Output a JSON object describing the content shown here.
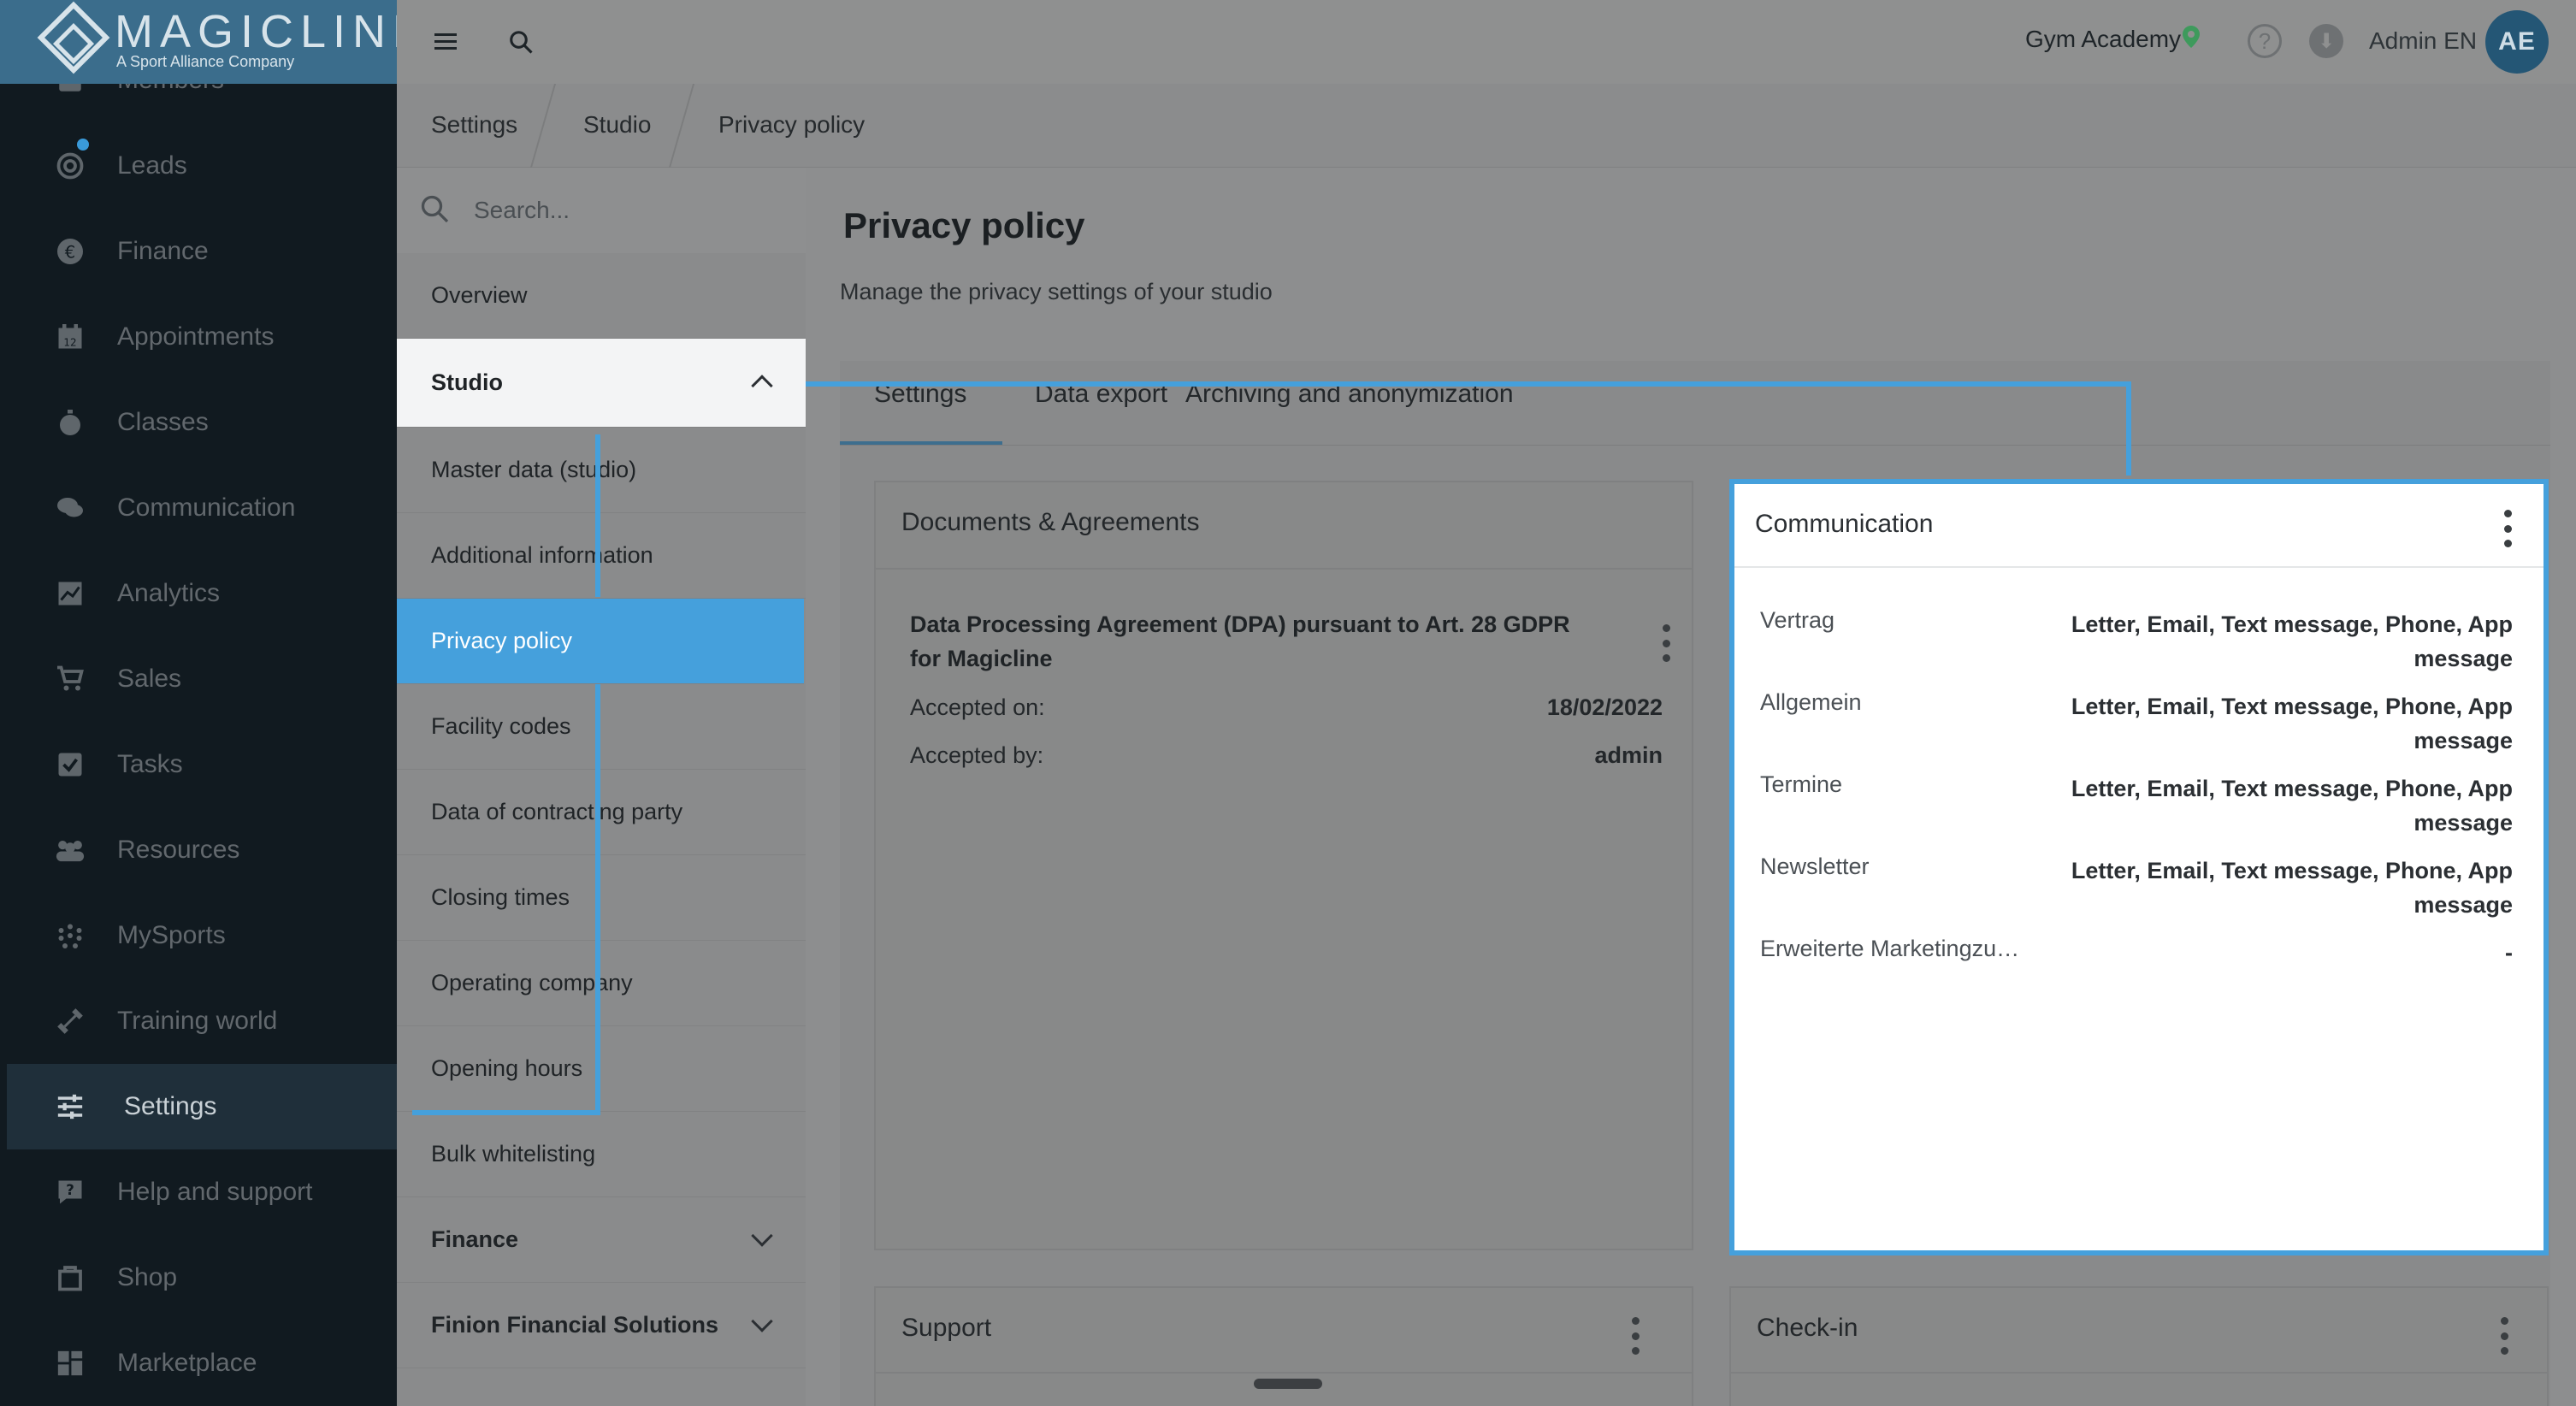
{
  "brand": {
    "name": "MAGICLINE",
    "tagline": "A Sport Alliance Company"
  },
  "nav": {
    "items": [
      {
        "label": "Members",
        "icon": "members-icon"
      },
      {
        "label": "Leads",
        "icon": "leads-icon"
      },
      {
        "label": "Finance",
        "icon": "euro-icon"
      },
      {
        "label": "Appointments",
        "icon": "calendar-icon"
      },
      {
        "label": "Classes",
        "icon": "stopwatch-icon"
      },
      {
        "label": "Communication",
        "icon": "chat-icon"
      },
      {
        "label": "Analytics",
        "icon": "chart-icon"
      },
      {
        "label": "Sales",
        "icon": "cart-icon"
      },
      {
        "label": "Tasks",
        "icon": "checkbox-icon"
      },
      {
        "label": "Resources",
        "icon": "people-icon"
      },
      {
        "label": "MySports",
        "icon": "dots-grid-icon"
      },
      {
        "label": "Training world",
        "icon": "dumbbell-icon"
      },
      {
        "label": "Settings",
        "icon": "sliders-icon"
      },
      {
        "label": "Help and support",
        "icon": "help-chat-icon"
      },
      {
        "label": "Shop",
        "icon": "shop-icon"
      },
      {
        "label": "Marketplace",
        "icon": "grid-icon"
      }
    ],
    "active": "Settings"
  },
  "topbar": {
    "studio": "Gym Academy",
    "user": "Admin EN",
    "avatar_initials": "AE"
  },
  "breadcrumb": [
    "Settings",
    "Studio",
    "Privacy policy"
  ],
  "subnav": {
    "search_placeholder": "Search...",
    "overview": "Overview",
    "studio_group": "Studio",
    "studio_items": [
      "Master data (studio)",
      "Additional information",
      "Privacy policy",
      "Facility codes",
      "Data of contracting party",
      "Closing times",
      "Operating company",
      "Opening hours",
      "Bulk whitelisting"
    ],
    "finance_group": "Finance",
    "finion_group": "Finion Financial Solutions"
  },
  "page": {
    "title": "Privacy policy",
    "subtitle": "Manage the privacy settings of your studio",
    "tabs": [
      "Settings",
      "Data export",
      "Archiving and anonymization"
    ]
  },
  "documents_card": {
    "title": "Documents & Agreements",
    "doc_title": "Data Processing Agreement (DPA) pursuant to Art. 28 GDPR for Magicline",
    "accepted_on_label": "Accepted on:",
    "accepted_on_value": "18/02/2022",
    "accepted_by_label": "Accepted by:",
    "accepted_by_value": "admin"
  },
  "communication_card": {
    "title": "Communication",
    "rows": [
      {
        "key": "Vertrag",
        "value": "Letter, Email, Text message, Phone, App message"
      },
      {
        "key": "Allgemein",
        "value": "Letter, Email, Text message, Phone, App message"
      },
      {
        "key": "Termine",
        "value": "Letter, Email, Text message, Phone, App message"
      },
      {
        "key": "Newsletter",
        "value": "Letter, Email, Text message, Phone, App message"
      },
      {
        "key": "Erweiterte Marketingzu…",
        "value": "-"
      }
    ]
  },
  "support_card": {
    "title": "Support"
  },
  "checkin_card": {
    "title": "Check-in"
  }
}
